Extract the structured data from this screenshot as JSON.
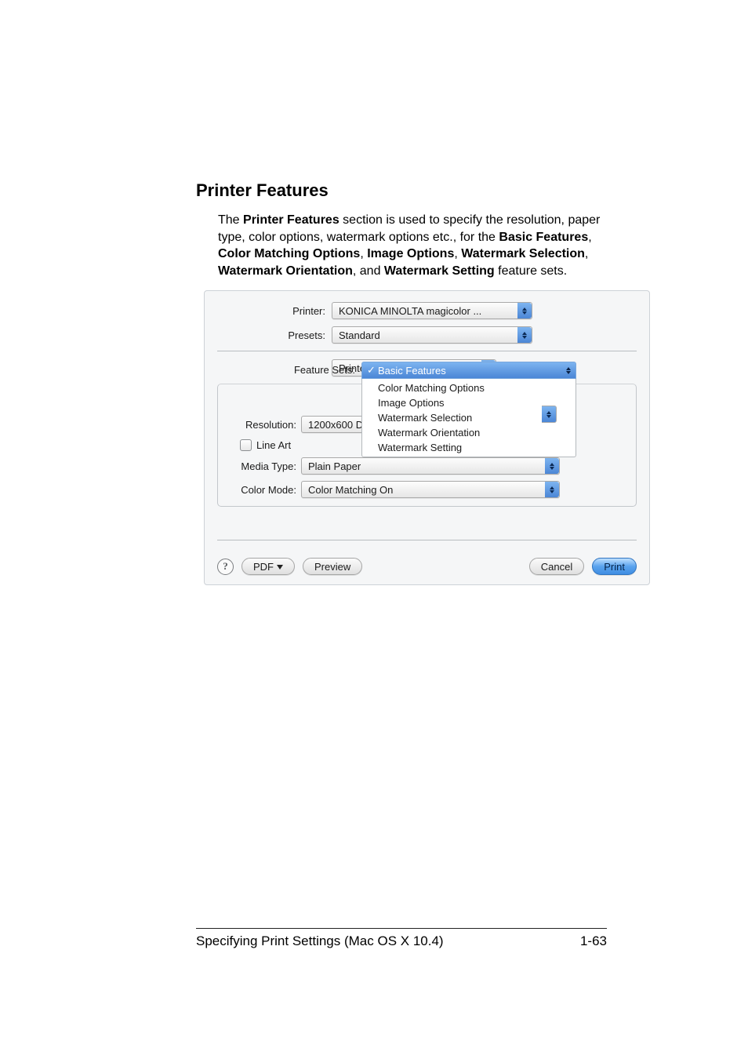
{
  "heading": "Printer Features",
  "paragraph": {
    "pre": "The ",
    "s1": "Printer Features",
    "t1": " section is used to specify the resolution, paper type, color options, watermark options etc., for the ",
    "s2": "Basic Features",
    "t2": ", ",
    "s3": "Color Matching Options",
    "t3": ", ",
    "s4": "Image Options",
    "t4": ", ",
    "s5": "Watermark Selection",
    "t5": ", ",
    "s6": "Watermark Orientation",
    "t6": ", and ",
    "s7": "Watermark Setting",
    "t7": " feature sets."
  },
  "dialog": {
    "printer_label": "Printer:",
    "printer_value": "KONICA MINOLTA magicolor ...",
    "presets_label": "Presets:",
    "presets_value": "Standard",
    "pane_value": "Printer Features",
    "feature_sets_label": "Feature Sets:",
    "feature_sets_selected": "Basic Features",
    "feature_sets_menu": [
      "Color Matching Options",
      "Image Options",
      "Watermark Selection",
      "Watermark Orientation",
      "Watermark Setting"
    ],
    "resolution_label": "Resolution:",
    "resolution_value": "1200x600 D",
    "lineart_label": "Line Art",
    "mediatype_label": "Media Type:",
    "mediatype_value": "Plain Paper",
    "colormode_label": "Color Mode:",
    "colormode_value": "Color Matching On",
    "help_char": "?",
    "pdf_label": "PDF",
    "preview_label": "Preview",
    "cancel_label": "Cancel",
    "print_label": "Print"
  },
  "footer": {
    "left": "Specifying Print Settings (Mac OS X 10.4)",
    "right": "1-63"
  }
}
